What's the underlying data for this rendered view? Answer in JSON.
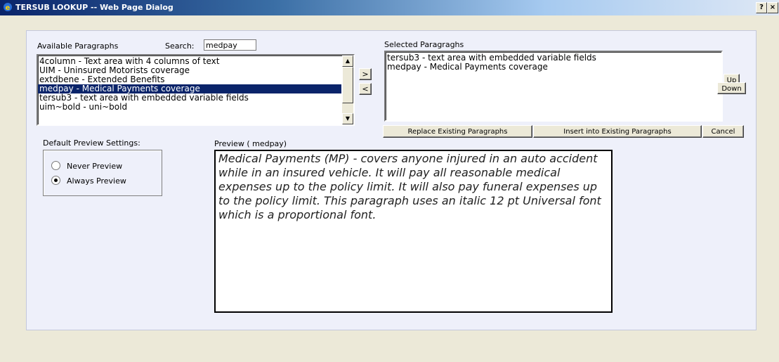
{
  "window": {
    "title": "TERSUB LOOKUP -- Web Page Dialog",
    "help_label": "?",
    "close_label": "×"
  },
  "available": {
    "label": "Available Paragraphs",
    "search_label": "Search:",
    "search_value": "medpay",
    "items": [
      "4column  -  Text area with 4 columns of text",
      "UIM  -  Uninsured Motorists coverage",
      "extdbene  -  Extended Benefits",
      "medpay  -  Medical Payments coverage",
      "tersub3  -  text area with embedded variable fields",
      "uim~bold  -  uni~bold"
    ],
    "selected_index": 3
  },
  "move": {
    "add_label": ">",
    "remove_label": "<"
  },
  "selected": {
    "label": "Selected Paragraghs",
    "items": [
      "tersub3  -  text area with embedded variable fields",
      "medpay  -  Medical Payments coverage"
    ],
    "up_label": "Up",
    "down_label": "Down"
  },
  "actions": {
    "replace_label": "Replace Existing Paragraphs",
    "insert_label": "Insert into Existing Paragraphs",
    "cancel_label": "Cancel"
  },
  "preview_settings": {
    "label": "Default Preview Settings:",
    "options": [
      "Never Preview",
      "Always Preview"
    ],
    "selected_option": 1
  },
  "preview": {
    "label": "Preview ( medpay)",
    "text": "Medical Payments (MP) - covers anyone injured in an auto accident while in an insured vehicle. It will pay all reasonable medical expenses up to the policy limit. It will also pay funeral expenses up to the policy limit. This paragraph uses an italic 12 pt Universal font which is a proportional font."
  }
}
